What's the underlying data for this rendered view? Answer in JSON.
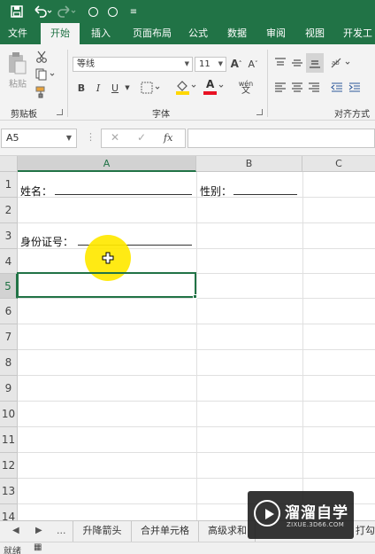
{
  "qat": {
    "save_icon": "save-icon",
    "undo_icon": "undo-icon",
    "redo_icon": "redo-icon",
    "customize_icon": "customize-qat-icon"
  },
  "ribbon_tabs": [
    "文件",
    "开始",
    "插入",
    "页面布局",
    "公式",
    "数据",
    "审阅",
    "视图",
    "开发工具"
  ],
  "active_tab": "开始",
  "clipboard": {
    "paste_label": "粘贴",
    "group_label": "剪贴板"
  },
  "font": {
    "name": "等线",
    "size": "11",
    "bold": "B",
    "italic": "I",
    "underline": "U",
    "grow": "A",
    "shrink": "A",
    "font_color": "A",
    "phonetic": "wén",
    "group_label": "字体"
  },
  "alignment": {
    "group_label": "对齐方式"
  },
  "formula_bar": {
    "name_box": "A5",
    "fx_label": "fx",
    "content": ""
  },
  "grid": {
    "columns": [
      "A",
      "B",
      "C"
    ],
    "selected_column": "A",
    "rows": [
      "1",
      "2",
      "3",
      "4",
      "5",
      "6",
      "7",
      "8",
      "9",
      "10",
      "11",
      "12",
      "13",
      "14"
    ],
    "selected_row": "5",
    "cells": {
      "a1": "姓名：",
      "b1": "性别：",
      "a3": "身份证号："
    }
  },
  "sheet_tabs": {
    "ellipsis": "...",
    "items": [
      "升降箭头",
      "合并单元格",
      "高级求和",
      "打勾"
    ]
  },
  "status": {
    "ready": "就绪"
  },
  "colors": {
    "excel_green": "#217346",
    "highlight_yellow": "#ffe800",
    "fill_color_bar": "#ffd700",
    "font_color_bar": "#e81123"
  },
  "watermark": {
    "title": "溜溜自学",
    "url": "ZIXUE.3D66.COM"
  }
}
